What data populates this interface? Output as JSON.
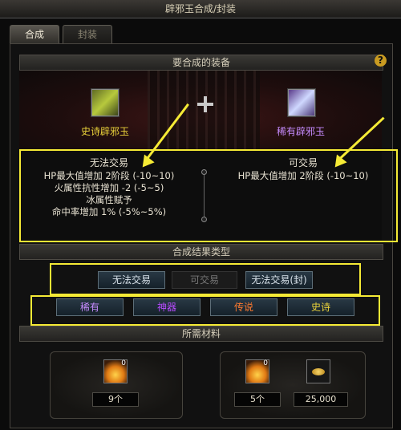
{
  "window": {
    "title": "辟邪玉合成/封装"
  },
  "tabs": [
    {
      "label": "合成"
    },
    {
      "label": "封装"
    }
  ],
  "sections": {
    "equipment_header": "要合成的装备",
    "result_type_header": "合成结果类型",
    "materials_header": "所需材料"
  },
  "left_item": {
    "name": "史诗辟邪玉",
    "trade": "无法交易",
    "props": [
      "HP最大值增加 2阶段 (-10~10)",
      "火属性抗性增加 -2 (-5~5)",
      "冰属性赋予",
      "命中率增加 1% (-5%~5%)"
    ]
  },
  "right_item": {
    "name": "稀有辟邪玉",
    "trade": "可交易",
    "props": [
      "HP最大值增加 2阶段 (-10~10)"
    ]
  },
  "trade_options": [
    "无法交易",
    "可交易",
    "无法交易(封)"
  ],
  "rarity_options": [
    "稀有",
    "神器",
    "传说",
    "史诗"
  ],
  "materials": {
    "left": {
      "icon_count": "0",
      "count": "9个"
    },
    "right": {
      "icon_count": "0",
      "count": "5个",
      "gold": "25,000"
    }
  },
  "colors": {
    "highlight_box": "#f5ea35",
    "epic": "#ead23a",
    "rare": "#c78cff",
    "artifact": "#b84cff",
    "legend": "#ff7a2f"
  }
}
